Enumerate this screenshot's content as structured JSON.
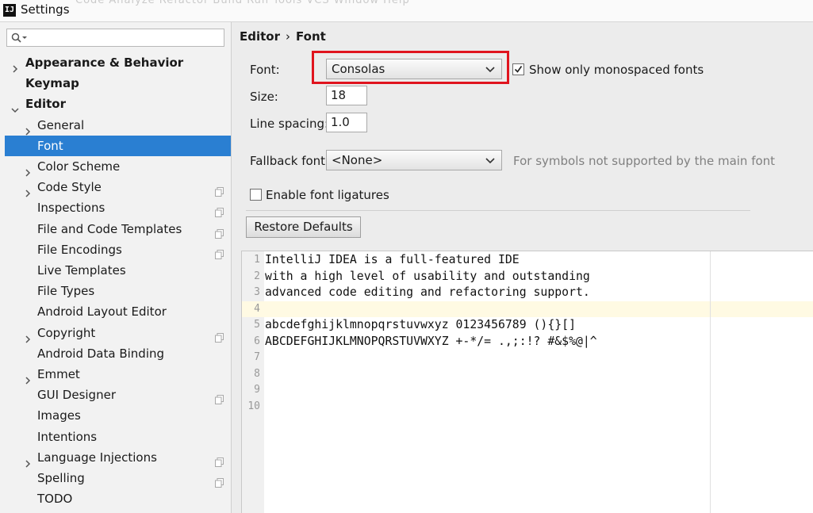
{
  "window": {
    "title": "Settings",
    "app_icon_text": "IJ",
    "ghost_menu": "Code  Analyze  Refactor  Build  Run  Tools  VCS  Window  Help"
  },
  "sidebar": {
    "search_placeholder": "",
    "items": [
      {
        "label": "Appearance & Behavior",
        "level": 0,
        "bold": true,
        "arrow": "collapsed",
        "copy": false,
        "selected": false
      },
      {
        "label": "Keymap",
        "level": 0,
        "bold": true,
        "arrow": "none",
        "copy": false,
        "selected": false
      },
      {
        "label": "Editor",
        "level": 0,
        "bold": true,
        "arrow": "expanded",
        "copy": false,
        "selected": false
      },
      {
        "label": "General",
        "level": 1,
        "bold": false,
        "arrow": "collapsed",
        "copy": false,
        "selected": false
      },
      {
        "label": "Font",
        "level": 1,
        "bold": false,
        "arrow": "none",
        "copy": false,
        "selected": true
      },
      {
        "label": "Color Scheme",
        "level": 1,
        "bold": false,
        "arrow": "collapsed",
        "copy": false,
        "selected": false
      },
      {
        "label": "Code Style",
        "level": 1,
        "bold": false,
        "arrow": "collapsed",
        "copy": true,
        "selected": false
      },
      {
        "label": "Inspections",
        "level": 1,
        "bold": false,
        "arrow": "none",
        "copy": true,
        "selected": false
      },
      {
        "label": "File and Code Templates",
        "level": 1,
        "bold": false,
        "arrow": "none",
        "copy": true,
        "selected": false
      },
      {
        "label": "File Encodings",
        "level": 1,
        "bold": false,
        "arrow": "none",
        "copy": true,
        "selected": false
      },
      {
        "label": "Live Templates",
        "level": 1,
        "bold": false,
        "arrow": "none",
        "copy": false,
        "selected": false
      },
      {
        "label": "File Types",
        "level": 1,
        "bold": false,
        "arrow": "none",
        "copy": false,
        "selected": false
      },
      {
        "label": "Android Layout Editor",
        "level": 1,
        "bold": false,
        "arrow": "none",
        "copy": false,
        "selected": false
      },
      {
        "label": "Copyright",
        "level": 1,
        "bold": false,
        "arrow": "collapsed",
        "copy": true,
        "selected": false
      },
      {
        "label": "Android Data Binding",
        "level": 1,
        "bold": false,
        "arrow": "none",
        "copy": false,
        "selected": false
      },
      {
        "label": "Emmet",
        "level": 1,
        "bold": false,
        "arrow": "collapsed",
        "copy": false,
        "selected": false
      },
      {
        "label": "GUI Designer",
        "level": 1,
        "bold": false,
        "arrow": "none",
        "copy": true,
        "selected": false
      },
      {
        "label": "Images",
        "level": 1,
        "bold": false,
        "arrow": "none",
        "copy": false,
        "selected": false
      },
      {
        "label": "Intentions",
        "level": 1,
        "bold": false,
        "arrow": "none",
        "copy": false,
        "selected": false
      },
      {
        "label": "Language Injections",
        "level": 1,
        "bold": false,
        "arrow": "collapsed",
        "copy": true,
        "selected": false
      },
      {
        "label": "Spelling",
        "level": 1,
        "bold": false,
        "arrow": "none",
        "copy": true,
        "selected": false
      },
      {
        "label": "TODO",
        "level": 1,
        "bold": false,
        "arrow": "none",
        "copy": false,
        "selected": false
      }
    ]
  },
  "breadcrumb": {
    "parent": "Editor",
    "separator": "›",
    "current": "Font"
  },
  "font_settings": {
    "font_label": "Font:",
    "font_value": "Consolas",
    "monospaced_label": "Show only monospaced fonts",
    "monospaced_checked": true,
    "size_label": "Size:",
    "size_value": "18",
    "line_spacing_label": "Line spacing:",
    "line_spacing_value": "1.0",
    "fallback_label": "Fallback font:",
    "fallback_value": "<None>",
    "fallback_hint": "For symbols not supported by the main font",
    "ligatures_label": "Enable font ligatures",
    "ligatures_checked": false,
    "restore_button": "Restore Defaults"
  },
  "preview": {
    "current_line": 4,
    "lines": [
      {
        "num": "1",
        "text": "IntelliJ IDEA is a full-featured IDE"
      },
      {
        "num": "2",
        "text": "with a high level of usability and outstanding"
      },
      {
        "num": "3",
        "text": "advanced code editing and refactoring support."
      },
      {
        "num": "4",
        "text": ""
      },
      {
        "num": "5",
        "text": "abcdefghijklmnopqrstuvwxyz 0123456789 (){}[]"
      },
      {
        "num": "6",
        "text": "ABCDEFGHIJKLMNOPQRSTUVWXYZ +-*/= .,;:!? #&$%@|^"
      },
      {
        "num": "7",
        "text": ""
      },
      {
        "num": "8",
        "text": ""
      },
      {
        "num": "9",
        "text": ""
      },
      {
        "num": "10",
        "text": ""
      }
    ]
  },
  "colors": {
    "selection": "#2a7fd2",
    "highlight_box": "#e0141e",
    "current_line": "#fffae3"
  }
}
